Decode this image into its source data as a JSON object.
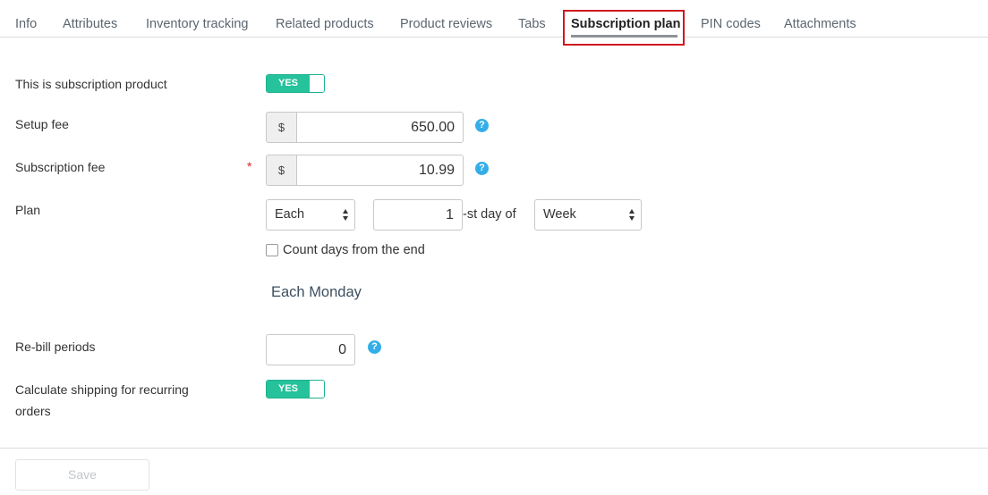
{
  "tabs": [
    {
      "label": "Info"
    },
    {
      "label": "Attributes"
    },
    {
      "label": "Inventory tracking"
    },
    {
      "label": "Related products"
    },
    {
      "label": "Product reviews"
    },
    {
      "label": "Tabs"
    },
    {
      "label": "Subscription plan",
      "active": true
    },
    {
      "label": "PIN codes"
    },
    {
      "label": "Attachments"
    }
  ],
  "form": {
    "subscription_product": {
      "label": "This is subscription product",
      "toggle_label": "YES",
      "on": true
    },
    "setup_fee": {
      "label": "Setup fee",
      "currency": "$",
      "value": "650.00",
      "help": "?"
    },
    "subscription_fee": {
      "label": "Subscription fee",
      "required_mark": "*",
      "currency": "$",
      "value": "10.99",
      "help": "?"
    },
    "plan": {
      "label": "Plan",
      "frequency": "Each",
      "day_number": "1",
      "day_suffix": "-st day of",
      "period": "Week",
      "count_from_end_label": "Count days from the end",
      "count_from_end_checked": false,
      "summary": "Each Monday"
    },
    "rebill_periods": {
      "label": "Re-bill periods",
      "value": "0",
      "help": "?"
    },
    "calculate_shipping": {
      "label_line1": "Calculate shipping for recurring",
      "label_line2": "orders",
      "toggle_label": "YES",
      "on": true
    }
  },
  "footer": {
    "save_label": "Save"
  },
  "colors": {
    "toggle_on": "#25c29b",
    "help_icon": "#34aee8",
    "active_tab_outline": "#d0181f",
    "required": "#e02020"
  }
}
